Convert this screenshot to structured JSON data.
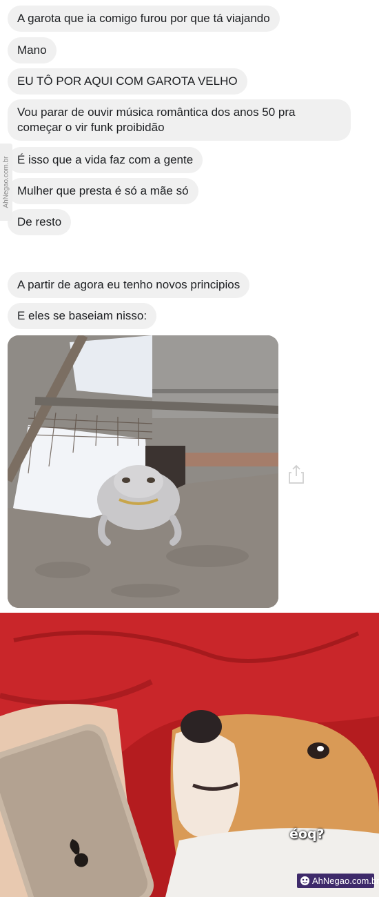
{
  "messages": [
    "A garota que ia comigo furou por que tá viajando",
    "Mano",
    "EU TÔ POR AQUI COM GAROTA VELHO",
    [
      "Vou parar de ouvir música romântica dos anos 50 pra",
      "começar o vir funk proibidão"
    ],
    "É isso que a vida faz com a gente",
    "Mulher que presta é só a mãe só",
    "De resto",
    "A partir de agora eu tenho novos principios",
    "E eles se baseiam nisso:"
  ],
  "side_watermark": "AhNegao.com.br",
  "meme": {
    "caption": "éoq?",
    "brand": "AhNegao.com.br"
  },
  "icons": {
    "share": "share-icon",
    "brand": "ahnegao-logo-icon"
  },
  "colors": {
    "bubble": "#f0f0f0",
    "text": "#1c1e21",
    "brand_bg": "#3e2a6a",
    "blanket_red": "#b01b1f"
  }
}
